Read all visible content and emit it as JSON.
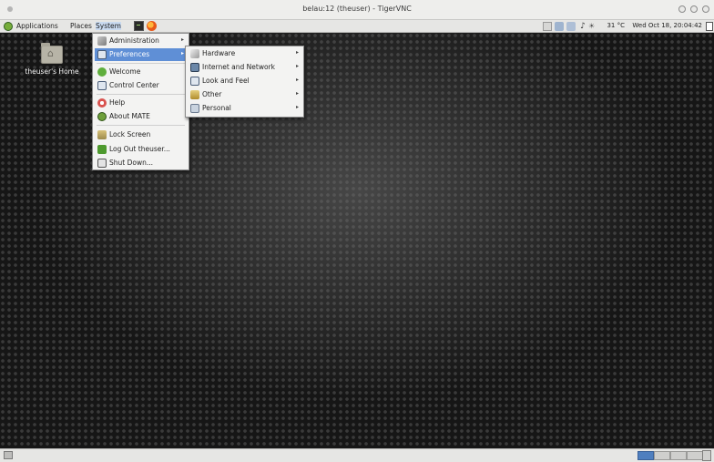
{
  "window": {
    "title": "belau:12 (theuser) - TigerVNC"
  },
  "panel": {
    "menus": [
      "Applications",
      "Places",
      "System"
    ],
    "temperature": "31 °C",
    "clock": "Wed Oct 18, 20:04:42"
  },
  "desktop": {
    "icon_label": "theuser's Home"
  },
  "system_menu": {
    "items": [
      {
        "label": "Administration",
        "icon": "administration-icon",
        "submenu": true
      },
      {
        "label": "Preferences",
        "icon": "preferences-icon",
        "submenu": true,
        "selected": true
      },
      {
        "label": "Welcome",
        "icon": "welcome-icon"
      },
      {
        "label": "Control Center",
        "icon": "control-center-icon"
      },
      {
        "label": "Help",
        "icon": "help-icon"
      },
      {
        "label": "About MATE",
        "icon": "mate-logo-icon"
      },
      {
        "label": "Lock Screen",
        "icon": "lock-screen-icon"
      },
      {
        "label": "Log Out theuser...",
        "icon": "log-out-icon"
      },
      {
        "label": "Shut Down...",
        "icon": "shut-down-icon"
      }
    ]
  },
  "preferences_menu": {
    "items": [
      {
        "label": "Hardware",
        "icon": "hardware-icon"
      },
      {
        "label": "Internet and Network",
        "icon": "network-icon"
      },
      {
        "label": "Look and Feel",
        "icon": "look-and-feel-icon"
      },
      {
        "label": "Other",
        "icon": "other-icon"
      },
      {
        "label": "Personal",
        "icon": "personal-icon"
      }
    ]
  },
  "colors": {
    "selection": "#5f8fd6",
    "panel": "#e6e6e4",
    "workspace_active": "#4f7fbf"
  }
}
